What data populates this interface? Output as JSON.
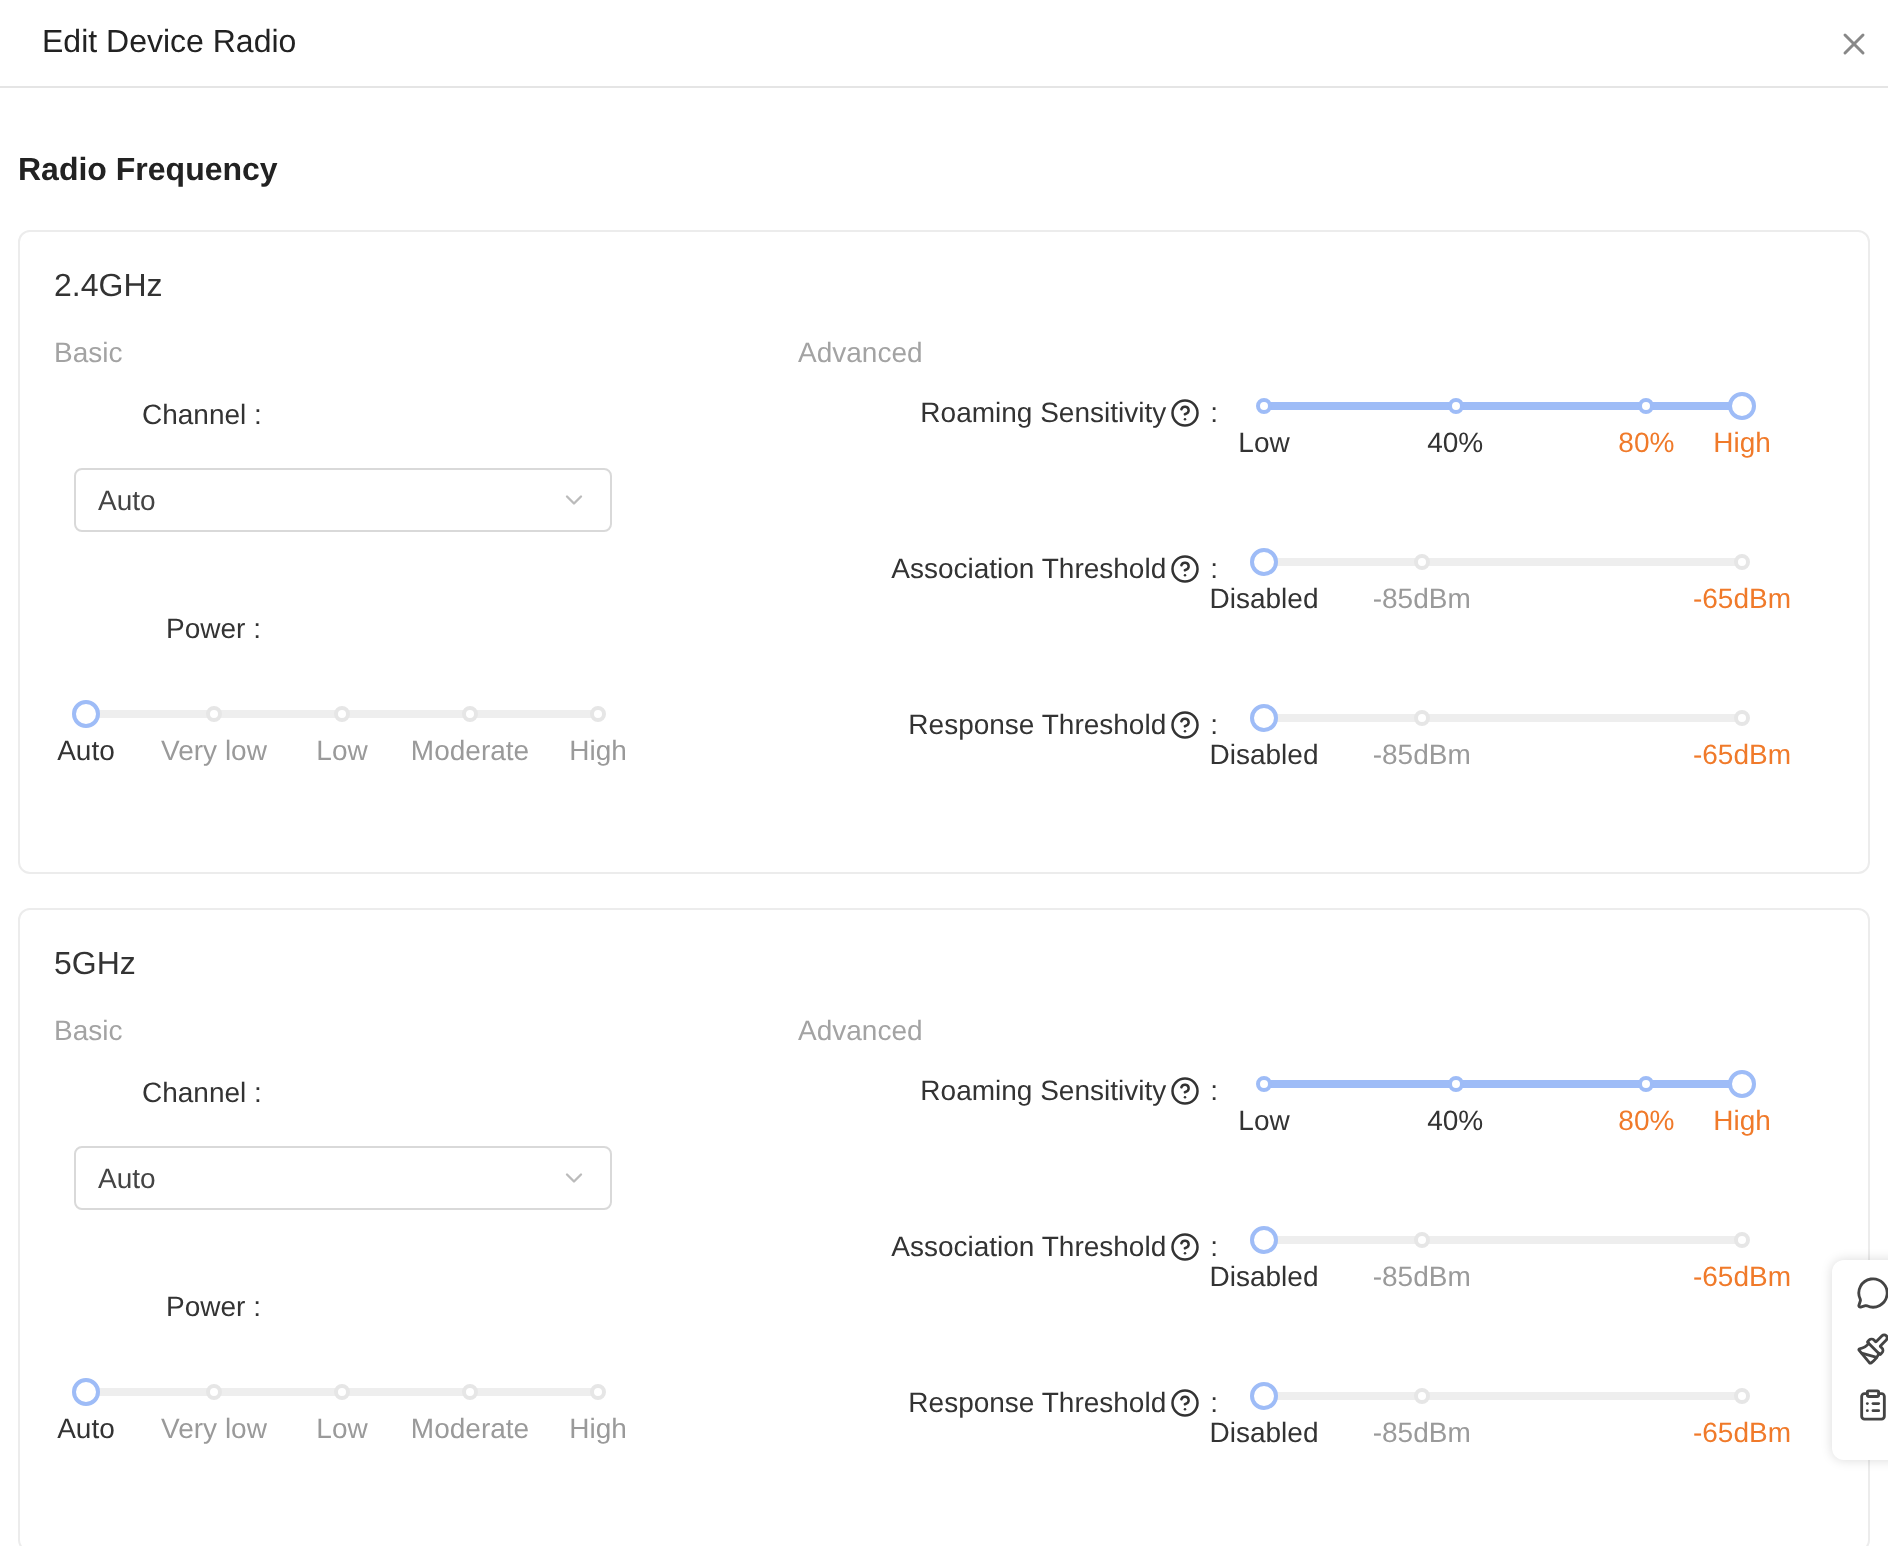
{
  "dialog": {
    "title": "Edit Device Radio"
  },
  "section_title": "Radio Frequency",
  "bands": [
    {
      "name": "2.4GHz",
      "basic": {
        "heading": "Basic",
        "channel": {
          "label": "Channel :",
          "value": "Auto"
        },
        "power": {
          "label": "Power :",
          "slider": {
            "kind": "power",
            "level": 0,
            "marks": [
              {
                "label": "Auto",
                "color": "#333333"
              },
              {
                "label": "Very low",
                "color": "#9a9a9a"
              },
              {
                "label": "Low",
                "color": "#9a9a9a"
              },
              {
                "label": "Moderate",
                "color": "#9a9a9a"
              },
              {
                "label": "High",
                "color": "#9a9a9a"
              }
            ]
          }
        }
      },
      "advanced": {
        "heading": "Advanced",
        "settings": [
          {
            "label": "Roaming Sensitivity",
            "suffix": ":",
            "slider": {
              "kind": "roaming",
              "level": 1,
              "marks": [
                {
                  "label": "Low",
                  "color": "#333333"
                },
                {
                  "label": "40%",
                  "color": "#333333"
                },
                {
                  "label": "80%",
                  "color": "#f07a2a"
                },
                {
                  "label": "High",
                  "color": "#f07a2a"
                }
              ]
            }
          },
          {
            "label": "Association Threshold",
            "suffix": ":",
            "slider": {
              "kind": "threshold",
              "level": 0,
              "marks": [
                {
                  "label": "Disabled",
                  "color": "#333333"
                },
                {
                  "label": "-85dBm",
                  "color": "#9a9a9a"
                },
                {
                  "label": "-65dBm",
                  "color": "#f07a2a"
                }
              ]
            }
          },
          {
            "label": "Response Threshold",
            "suffix": ":",
            "slider": {
              "kind": "threshold",
              "level": 0,
              "marks": [
                {
                  "label": "Disabled",
                  "color": "#333333"
                },
                {
                  "label": "-85dBm",
                  "color": "#9a9a9a"
                },
                {
                  "label": "-65dBm",
                  "color": "#f07a2a"
                }
              ]
            }
          }
        ]
      }
    },
    {
      "name": "5GHz",
      "basic": {
        "heading": "Basic",
        "channel": {
          "label": "Channel :",
          "value": "Auto"
        },
        "power": {
          "label": "Power :",
          "slider": {
            "kind": "power",
            "level": 0,
            "marks": [
              {
                "label": "Auto",
                "color": "#333333"
              },
              {
                "label": "Very low",
                "color": "#9a9a9a"
              },
              {
                "label": "Low",
                "color": "#9a9a9a"
              },
              {
                "label": "Moderate",
                "color": "#9a9a9a"
              },
              {
                "label": "High",
                "color": "#9a9a9a"
              }
            ]
          }
        }
      },
      "advanced": {
        "heading": "Advanced",
        "settings": [
          {
            "label": "Roaming Sensitivity",
            "suffix": ":",
            "slider": {
              "kind": "roaming",
              "level": 1,
              "marks": [
                {
                  "label": "Low",
                  "color": "#333333"
                },
                {
                  "label": "40%",
                  "color": "#333333"
                },
                {
                  "label": "80%",
                  "color": "#f07a2a"
                },
                {
                  "label": "High",
                  "color": "#f07a2a"
                }
              ]
            }
          },
          {
            "label": "Association Threshold",
            "suffix": ":",
            "slider": {
              "kind": "threshold",
              "level": 0,
              "marks": [
                {
                  "label": "Disabled",
                  "color": "#333333"
                },
                {
                  "label": "-85dBm",
                  "color": "#9a9a9a"
                },
                {
                  "label": "-65dBm",
                  "color": "#f07a2a"
                }
              ]
            }
          },
          {
            "label": "Response Threshold",
            "suffix": ":",
            "slider": {
              "kind": "threshold",
              "level": 0,
              "marks": [
                {
                  "label": "Disabled",
                  "color": "#333333"
                },
                {
                  "label": "-85dBm",
                  "color": "#9a9a9a"
                },
                {
                  "label": "-65dBm",
                  "color": "#f07a2a"
                }
              ]
            }
          }
        ]
      }
    }
  ]
}
